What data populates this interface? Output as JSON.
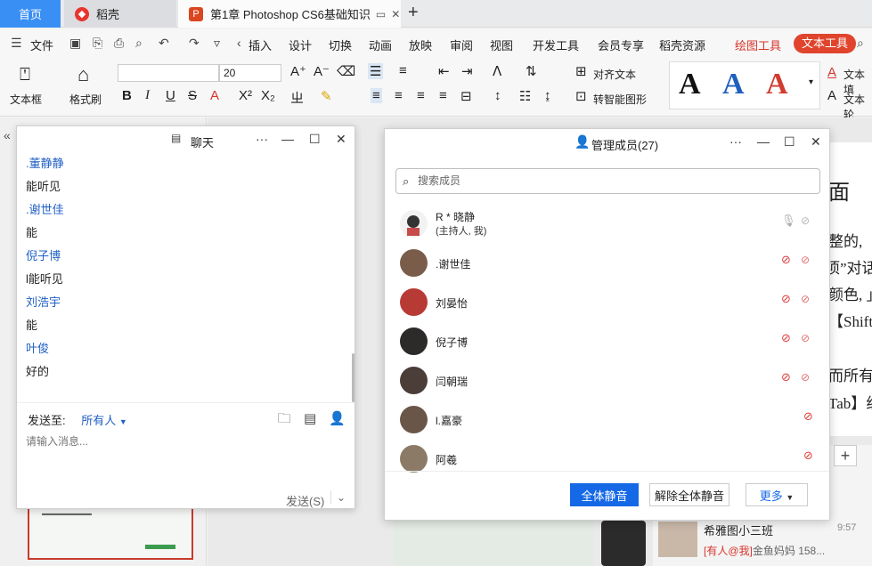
{
  "tabs": {
    "home": "首页",
    "t1": "稻壳",
    "t2": "第1章  Photoshop CS6基础知识",
    "plus": "+"
  },
  "menu": {
    "file": "文件",
    "items": [
      "插入",
      "设计",
      "切换",
      "动画",
      "放映",
      "审阅",
      "视图",
      "开发工具",
      "会员专享",
      "稻壳资源"
    ],
    "drawing_tools": "绘图工具",
    "text_tools": "文本工具"
  },
  "ribbon": {
    "textbox": "文本框",
    "format_painter": "格式刷",
    "font_name": "",
    "font_size": "20",
    "align_text": "对齐文本",
    "smart_shape": "转智能图形",
    "text_fill": "文本填",
    "text_outline": "文本轮",
    "style_letters": [
      "A",
      "A",
      "A"
    ],
    "style_colors": [
      "#111111",
      "#1f5fbf",
      "#d23b2f"
    ]
  },
  "chat": {
    "title": "聊天",
    "messages": [
      {
        "text": ".董静静",
        "is_name": true
      },
      {
        "text": "能听见",
        "is_name": false
      },
      {
        "text": ".谢世佳",
        "is_name": true
      },
      {
        "text": "能",
        "is_name": false
      },
      {
        "text": "倪子博",
        "is_name": true
      },
      {
        "text": "l能听见",
        "is_name": false
      },
      {
        "text": "刘浩宇",
        "is_name": true
      },
      {
        "text": "能",
        "is_name": false
      },
      {
        "text": "叶俊",
        "is_name": true
      },
      {
        "text": "好的",
        "is_name": false
      }
    ],
    "send_to_label": "发送至:",
    "send_to_value": "所有人",
    "input_placeholder": "请输入消息...",
    "send_label": "发送(S)"
  },
  "members": {
    "title": "管理成员(27)",
    "search_placeholder": "搜索成员",
    "list": [
      {
        "name": "R * 晓静",
        "sub": "(主持人, 我)",
        "mic_muted": false,
        "avatar": "#3a3a3a"
      },
      {
        "name": ".谢世佳",
        "sub": "",
        "mic_muted": true,
        "avatar": "#7a5c4a"
      },
      {
        "name": "刘晏怡",
        "sub": "",
        "mic_muted": true,
        "avatar": "#b83a34"
      },
      {
        "name": "倪子博",
        "sub": "",
        "mic_muted": true,
        "avatar": "#2d2a2a"
      },
      {
        "name": "闫朝瑞",
        "sub": "",
        "mic_muted": true,
        "avatar": "#4b3d38"
      },
      {
        "name": "l.嘉豪",
        "sub": "",
        "mic_muted": true,
        "avatar": "#6a5648"
      },
      {
        "name": "阿羲",
        "sub": "",
        "mic_muted": true,
        "avatar": "#8b7a66"
      }
    ],
    "mute_all": "全体静音",
    "unmute_all": "解除全体静音",
    "more": "更多"
  },
  "background": {
    "doc_lines": [
      "面",
      "整的,",
      "项”对话",
      "颜色, 」",
      "【Shift",
      "",
      "而所有说",
      "Tab】组"
    ],
    "right_chat_title": "希雅图小三班",
    "right_chat_time": "9:57",
    "right_chat_at": "[有人@我]",
    "right_chat_preview": "金鱼妈妈 158..."
  }
}
